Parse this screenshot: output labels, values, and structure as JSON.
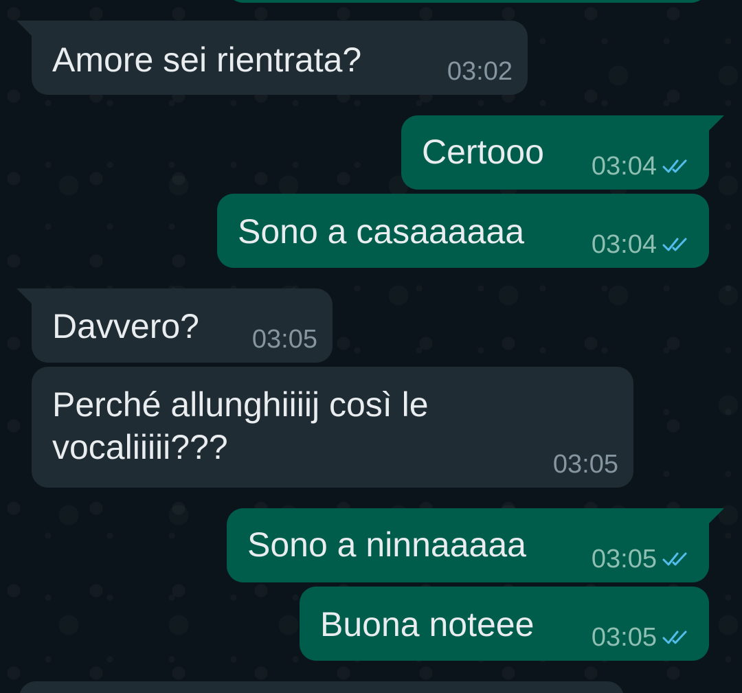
{
  "colors": {
    "background": "#0b141a",
    "incoming_bubble": "#202c33",
    "outgoing_bubble": "#005c4b",
    "text": "#e9edef",
    "incoming_time": "#8696a0",
    "outgoing_time": "#8fbfb3",
    "read_ticks": "#53bdeb"
  },
  "messages": [
    {
      "direction": "incoming",
      "text": "Amore sei rientrata?",
      "time": "03:02",
      "status": ""
    },
    {
      "direction": "outgoing",
      "text": "Certooo",
      "time": "03:04",
      "status": "read"
    },
    {
      "direction": "outgoing",
      "text": "Sono a casaaaaaa",
      "time": "03:04",
      "status": "read"
    },
    {
      "direction": "incoming",
      "text": "Davvero?",
      "time": "03:05",
      "status": ""
    },
    {
      "direction": "incoming",
      "text": "Perché allunghiiiij così le\nvocaliiiii???",
      "time": "03:05",
      "status": ""
    },
    {
      "direction": "outgoing",
      "text": "Sono a ninnaaaaa",
      "time": "03:05",
      "status": "read"
    },
    {
      "direction": "outgoing",
      "text": "Buona noteee",
      "time": "03:05",
      "status": "read"
    }
  ]
}
